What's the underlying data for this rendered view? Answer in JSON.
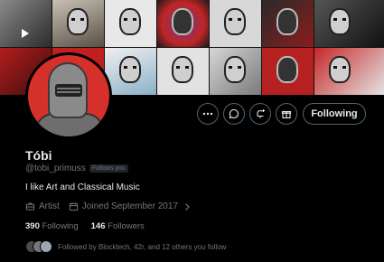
{
  "profile": {
    "name": "Tóbi",
    "handle": "@tobi_primuss",
    "follows_you": "Follows you",
    "bio": "I like Art and Classical Music",
    "category": "Artist",
    "joined": "Joined September 2017",
    "following_count": "390",
    "following_label": "Following",
    "followers_count": "146",
    "followers_label": "Followers",
    "followed_by": "Followed by Blocktech, 42r, and 12 others you follow"
  },
  "actions": {
    "more_icon": "more-horizontal-icon",
    "message_icon": "message-icon",
    "notify_icon": "bell-plus-icon",
    "subscribe_icon": "gift-icon",
    "follow_label": "Following"
  },
  "colors": {
    "avatar_bg": "#d6302b",
    "muted": "#71767b",
    "border": "#536471",
    "text": "#e7e9ea"
  }
}
